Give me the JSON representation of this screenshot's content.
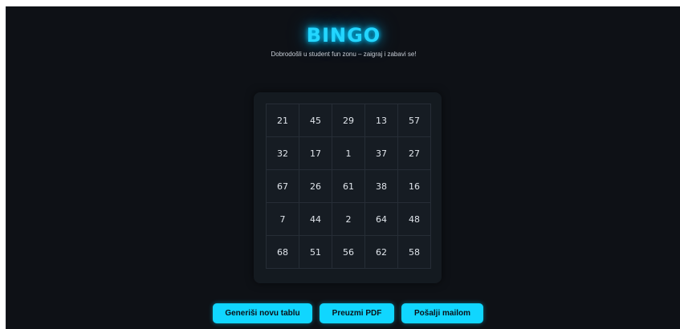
{
  "header": {
    "title": "BINGO",
    "subtitle": "Dobrodošli u student fun zonu – zaigraj i zabavi se!"
  },
  "board": {
    "rows": [
      [
        "21",
        "45",
        "29",
        "13",
        "57"
      ],
      [
        "32",
        "17",
        "1",
        "37",
        "27"
      ],
      [
        "67",
        "26",
        "61",
        "38",
        "16"
      ],
      [
        "7",
        "44",
        "2",
        "64",
        "48"
      ],
      [
        "68",
        "51",
        "56",
        "62",
        "58"
      ]
    ]
  },
  "actions": {
    "generate_label": "Generiši novu tablu",
    "pdf_label": "Preuzmi PDF",
    "mail_label": "Pošalji mailom"
  },
  "colors": {
    "accent": "#10d6ff",
    "background": "#0e1116",
    "card": "#141a20"
  }
}
